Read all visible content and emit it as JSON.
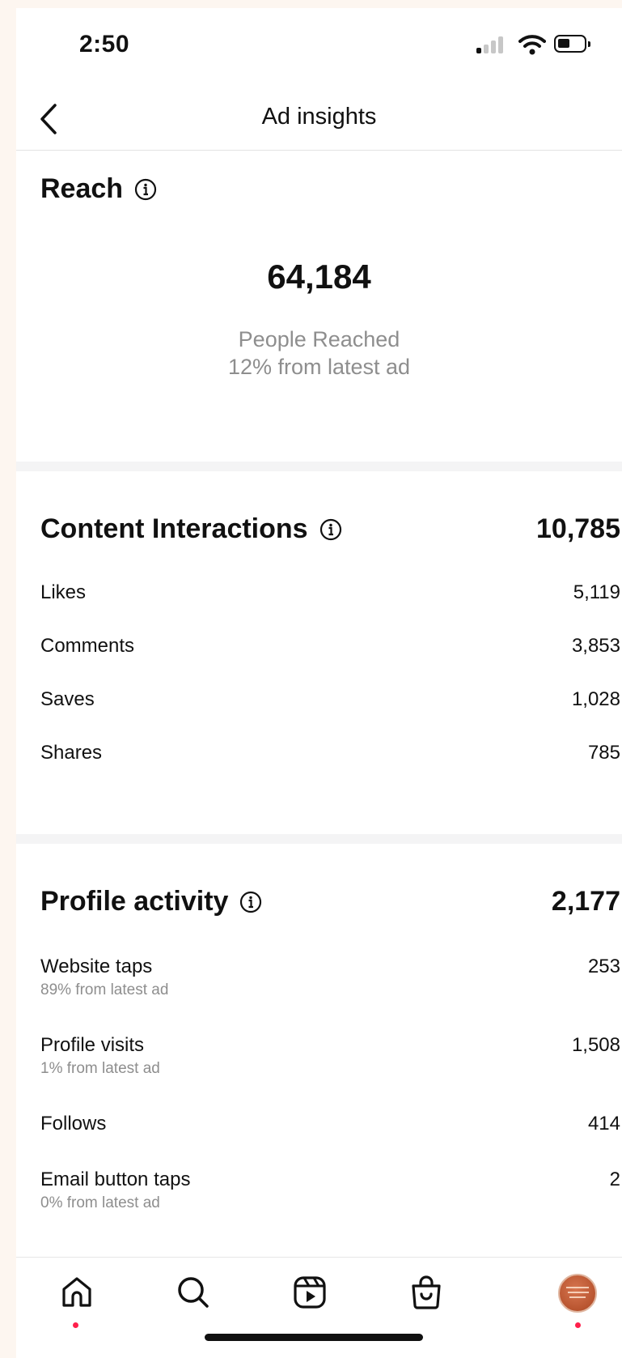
{
  "status_bar": {
    "time": "2:50"
  },
  "nav": {
    "title": "Ad insights"
  },
  "reach": {
    "title": "Reach",
    "value": "64,184",
    "caption_line1": "People Reached",
    "caption_line2": "12% from latest ad"
  },
  "content_interactions": {
    "title": "Content Interactions",
    "total": "10,785",
    "rows": [
      {
        "label": "Likes",
        "value": "5,119"
      },
      {
        "label": "Comments",
        "value": "3,853"
      },
      {
        "label": "Saves",
        "value": "1,028"
      },
      {
        "label": "Shares",
        "value": "785"
      }
    ]
  },
  "profile_activity": {
    "title": "Profile activity",
    "total": "2,177",
    "rows": [
      {
        "label": "Website taps",
        "sub": "89% from latest ad",
        "value": "253"
      },
      {
        "label": "Profile visits",
        "sub": "1% from latest ad",
        "value": "1,508"
      },
      {
        "label": "Follows",
        "value": "414"
      },
      {
        "label": "Email button taps",
        "sub": "0% from latest ad",
        "value": "2"
      }
    ]
  },
  "tab_bar": {
    "items": [
      "home-icon",
      "search-icon",
      "reels-icon",
      "shop-icon",
      "profile-avatar"
    ],
    "accent": "#ff1f4b"
  },
  "colors": {
    "background": "#f4f4f5",
    "muted_text": "#8e8e8e"
  }
}
